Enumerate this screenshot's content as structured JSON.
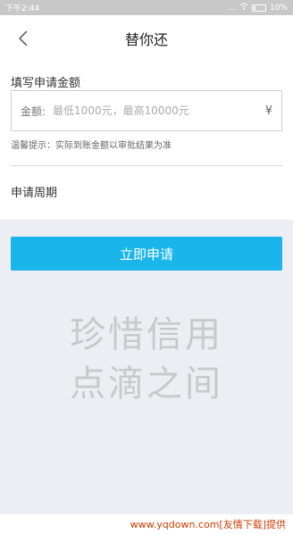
{
  "status_bar": {
    "time": "下午2:44",
    "signal_text": "...",
    "battery": "10%"
  },
  "header": {
    "title": "替你还",
    "back_icon": "chevron-left-icon"
  },
  "form": {
    "amount_section_label": "填写申请金额",
    "amount_label": "金额:",
    "amount_placeholder": "最低1000元，最高10000元",
    "currency_symbol": "¥",
    "tip": "温馨提示：实际到账金额以审批结果为准",
    "period_label": "申请周期"
  },
  "actions": {
    "apply_label": "立即申请"
  },
  "slogan": {
    "line1": "珍惜信用",
    "line2": "点滴之间"
  },
  "footer": {
    "credit": "www.yqdown.com[友情下载]提供"
  },
  "colors": {
    "accent": "#1ab5ea",
    "background_grey": "#eceef4",
    "slogan": "#c9c9c9"
  }
}
